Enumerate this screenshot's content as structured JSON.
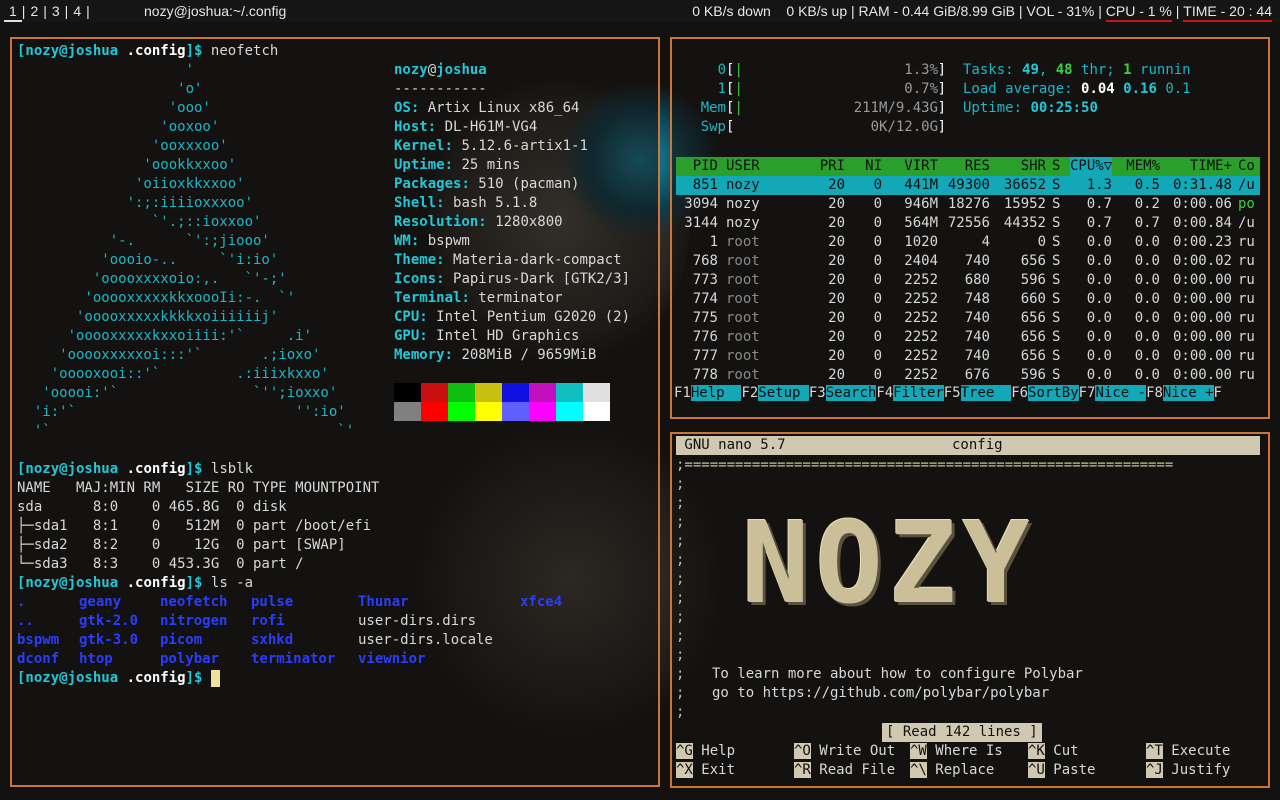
{
  "colors": {
    "border": "#c8763a",
    "cyan": "#18b8c8",
    "blue": "#2a3cff",
    "htop_header": "#2aa02a",
    "htop_select": "#12a8b8",
    "nano_bar": "#d0c8b0"
  },
  "bar": {
    "workspaces": [
      "1",
      "2",
      "3",
      "4"
    ],
    "window_title": "nozy@joshua:~/.config",
    "net_down": "0 KB/s down",
    "net_up": "0 KB/s up",
    "ram": "RAM - 0.44 GiB/8.99 GiB",
    "vol": "VOL - 31%",
    "cpu": "CPU -  1 %",
    "time": "TIME - 20 : 44"
  },
  "term": {
    "prompt_user": "[nozy@joshua",
    "prompt_dir": " .config",
    "prompt_end": "]$ ",
    "cmd1": "neofetch",
    "cmd2": "lsblk",
    "cmd3": "ls -a",
    "art": [
      "                    '",
      "                   'o'",
      "                  'ooo'",
      "                 'ooxoo'",
      "                'ooxxxoo'",
      "               'oookkxxoo'",
      "              'oiioxkkxxoo'",
      "             ':;:iiiioxxxoo'",
      "                `'.;::ioxxoo'",
      "           '-.      `':;jiooo'",
      "          'oooio-..     `'i:io'",
      "         'ooooxxxxoio:,.   `'-;'",
      "        'ooooxxxxxkkxoooIi:-.  `'",
      "       'ooooxxxxxkkkkxoiiiiiij'",
      "      'ooooxxxxxkxxoiiii:'`     .i'",
      "     'ooooxxxxxoi:::'`       .;ioxo'",
      "    'ooooxooi::'`         .:iiixkxxo'",
      "   'ooooi:'`                `'';ioxxo'",
      "  'i:'`                          '':io'",
      "  '`                                  `'"
    ],
    "info_user": "nozy",
    "info_at": "@",
    "info_host": "joshua",
    "info_sep": "-----------",
    "info": [
      {
        "k": "OS",
        "v": "Artix Linux x86_64"
      },
      {
        "k": "Host",
        "v": "DL-H61M-VG4"
      },
      {
        "k": "Kernel",
        "v": "5.12.6-artix1-1"
      },
      {
        "k": "Uptime",
        "v": "25 mins"
      },
      {
        "k": "Packages",
        "v": "510 (pacman)"
      },
      {
        "k": "Shell",
        "v": "bash 5.1.8"
      },
      {
        "k": "Resolution",
        "v": "1280x800"
      },
      {
        "k": "WM",
        "v": "bspwm"
      },
      {
        "k": "Theme",
        "v": "Materia-dark-compact"
      },
      {
        "k": "Icons",
        "v": "Papirus-Dark [GTK2/3]"
      },
      {
        "k": "Terminal",
        "v": "terminator"
      },
      {
        "k": "CPU",
        "v": "Intel Pentium G2020 (2)"
      },
      {
        "k": "GPU",
        "v": "Intel HD Graphics"
      },
      {
        "k": "Memory",
        "v": "208MiB / 9659MiB"
      }
    ],
    "swatches_top": [
      "#000000",
      "#c81010",
      "#10c010",
      "#c8c010",
      "#1010e0",
      "#c010c0",
      "#10c0c0",
      "#e0e0e0"
    ],
    "swatches_bot": [
      "#808080",
      "#ff0000",
      "#00ff00",
      "#ffff00",
      "#6060ff",
      "#ff00ff",
      "#00ffff",
      "#ffffff"
    ],
    "lsblk": [
      "NAME   MAJ:MIN RM   SIZE RO TYPE MOUNTPOINT",
      "sda      8:0    0 465.8G  0 disk",
      "├─sda1   8:1    0   512M  0 part /boot/efi",
      "├─sda2   8:2    0    12G  0 part [SWAP]",
      "└─sda3   8:3    0 453.3G  0 part /"
    ],
    "ls": [
      [
        {
          "t": ".",
          "c": "blue"
        },
        {
          "t": "geany",
          "c": "blue"
        },
        {
          "t": "neofetch",
          "c": "blue"
        },
        {
          "t": "pulse",
          "c": "blue"
        },
        {
          "t": "Thunar",
          "c": "blue"
        },
        {
          "t": "xfce4",
          "c": "blue"
        }
      ],
      [
        {
          "t": "..",
          "c": "blue"
        },
        {
          "t": "gtk-2.0",
          "c": "blue"
        },
        {
          "t": "nitrogen",
          "c": "blue"
        },
        {
          "t": "rofi",
          "c": "blue"
        },
        {
          "t": "user-dirs.dirs",
          "c": "plain"
        },
        {
          "t": "",
          "c": "plain"
        }
      ],
      [
        {
          "t": "bspwm",
          "c": "blue"
        },
        {
          "t": "gtk-3.0",
          "c": "blue"
        },
        {
          "t": "picom",
          "c": "blue"
        },
        {
          "t": "sxhkd",
          "c": "blue"
        },
        {
          "t": "user-dirs.locale",
          "c": "plain"
        },
        {
          "t": "",
          "c": "plain"
        }
      ],
      [
        {
          "t": "dconf",
          "c": "blue"
        },
        {
          "t": "htop",
          "c": "blue"
        },
        {
          "t": "polybar",
          "c": "blue"
        },
        {
          "t": "terminator",
          "c": "blue"
        },
        {
          "t": "viewnior",
          "c": "blue"
        },
        {
          "t": "",
          "c": "plain"
        }
      ]
    ]
  },
  "htop": {
    "cpu0": {
      "label": "0",
      "pct": "1.3%",
      "level": 0.013
    },
    "cpu1": {
      "label": "1",
      "pct": "0.7%",
      "level": 0.007
    },
    "mem": {
      "label": "Mem",
      "val": "211M/9.43G",
      "level": 0.022
    },
    "swp": {
      "label": "Swp",
      "val": "0K/12.0G",
      "level": 0.0
    },
    "tasks_label": "Tasks: ",
    "tasks": "49",
    "thr": "48",
    "thr_label": " thr; ",
    "running": "1",
    "running_label": " runnin",
    "load_label": "Load average: ",
    "load1": "0.04",
    "load5": "0.16",
    "load15": "0.1",
    "uptime_label": "Uptime: ",
    "uptime": "00:25:50",
    "headers": [
      "PID",
      "USER",
      "PRI",
      "NI",
      "VIRT",
      "RES",
      "SHR",
      "S",
      "CPU%▽",
      "MEM%",
      "TIME+",
      "Co"
    ],
    "rows": [
      [
        "851",
        "nozy",
        "20",
        "0",
        "441M",
        "49300",
        "36652",
        "S",
        "1.3",
        "0.5",
        "0:31.48",
        "/u"
      ],
      [
        "3094",
        "nozy",
        "20",
        "0",
        "946M",
        "18276",
        "15952",
        "S",
        "0.7",
        "0.2",
        "0:00.06",
        "po"
      ],
      [
        "3144",
        "nozy",
        "20",
        "0",
        "564M",
        "72556",
        "44352",
        "S",
        "0.7",
        "0.7",
        "0:00.84",
        "/u"
      ],
      [
        "1",
        "root",
        "20",
        "0",
        "1020",
        "4",
        "0",
        "S",
        "0.0",
        "0.0",
        "0:00.23",
        "ru"
      ],
      [
        "768",
        "root",
        "20",
        "0",
        "2404",
        "740",
        "656",
        "S",
        "0.0",
        "0.0",
        "0:00.02",
        "ru"
      ],
      [
        "773",
        "root",
        "20",
        "0",
        "2252",
        "680",
        "596",
        "S",
        "0.0",
        "0.0",
        "0:00.00",
        "ru"
      ],
      [
        "774",
        "root",
        "20",
        "0",
        "2252",
        "748",
        "660",
        "S",
        "0.0",
        "0.0",
        "0:00.00",
        "ru"
      ],
      [
        "775",
        "root",
        "20",
        "0",
        "2252",
        "740",
        "656",
        "S",
        "0.0",
        "0.0",
        "0:00.00",
        "ru"
      ],
      [
        "776",
        "root",
        "20",
        "0",
        "2252",
        "740",
        "656",
        "S",
        "0.0",
        "0.0",
        "0:00.00",
        "ru"
      ],
      [
        "777",
        "root",
        "20",
        "0",
        "2252",
        "740",
        "656",
        "S",
        "0.0",
        "0.0",
        "0:00.00",
        "ru"
      ],
      [
        "778",
        "root",
        "20",
        "0",
        "2252",
        "676",
        "596",
        "S",
        "0.0",
        "0.0",
        "0:00.00",
        "ru"
      ]
    ],
    "fkeys": [
      {
        "k": "F1",
        "l": "Help  "
      },
      {
        "k": "F2",
        "l": "Setup "
      },
      {
        "k": "F3",
        "l": "Search"
      },
      {
        "k": "F4",
        "l": "Filter"
      },
      {
        "k": "F5",
        "l": "Tree  "
      },
      {
        "k": "F6",
        "l": "SortBy"
      },
      {
        "k": "F7",
        "l": "Nice -"
      },
      {
        "k": "F8",
        "l": "Nice +"
      },
      {
        "k": "F",
        "l": ""
      }
    ]
  },
  "nano": {
    "version": " GNU nano 5.7",
    "filename": "config",
    "rule": ";==========================================================",
    "semicolon": ";",
    "banner": "NOZY",
    "msg1": "To learn more about how to configure Polybar",
    "msg2": "go to https://github.com/polybar/polybar",
    "status": "[ Read 142 lines ]",
    "shortcuts": [
      [
        {
          "k": "^G",
          "l": "Help"
        },
        {
          "k": "^O",
          "l": "Write Out"
        },
        {
          "k": "^W",
          "l": "Where Is"
        },
        {
          "k": "^K",
          "l": "Cut"
        },
        {
          "k": "^T",
          "l": "Execute"
        }
      ],
      [
        {
          "k": "^X",
          "l": "Exit"
        },
        {
          "k": "^R",
          "l": "Read File"
        },
        {
          "k": "^\\",
          "l": "Replace"
        },
        {
          "k": "^U",
          "l": "Paste"
        },
        {
          "k": "^J",
          "l": "Justify"
        }
      ]
    ]
  }
}
